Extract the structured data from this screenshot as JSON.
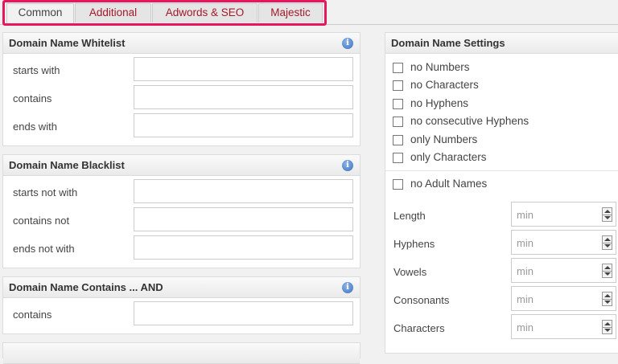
{
  "tabs": [
    {
      "label": "Common",
      "active": true
    },
    {
      "label": "Additional",
      "active": false
    },
    {
      "label": "Adwords & SEO",
      "active": false
    },
    {
      "label": "Majestic",
      "active": false
    }
  ],
  "highlight_color": "#e8175d",
  "accent_link_color": "#a3192a",
  "whitelist": {
    "title": "Domain Name Whitelist",
    "rows": [
      {
        "label": "starts with",
        "value": ""
      },
      {
        "label": "contains",
        "value": ""
      },
      {
        "label": "ends with",
        "value": ""
      }
    ]
  },
  "blacklist": {
    "title": "Domain Name Blacklist",
    "rows": [
      {
        "label": "starts not with",
        "value": ""
      },
      {
        "label": "contains not",
        "value": ""
      },
      {
        "label": "ends not with",
        "value": ""
      }
    ]
  },
  "contains_and": {
    "title": "Domain Name Contains ... AND",
    "rows": [
      {
        "label": "contains",
        "value": ""
      }
    ]
  },
  "settings": {
    "title": "Domain Name Settings",
    "checkboxes": [
      {
        "label": "no Numbers",
        "checked": false
      },
      {
        "label": "no Characters",
        "checked": false
      },
      {
        "label": "no Hyphens",
        "checked": false
      },
      {
        "label": "no consecutive Hyphens",
        "checked": false
      },
      {
        "label": "only Numbers",
        "checked": false
      },
      {
        "label": "only Characters",
        "checked": false
      }
    ],
    "adult": {
      "label": "no Adult Names",
      "checked": false
    },
    "numeric_fields": [
      {
        "label": "Length",
        "placeholder": "min"
      },
      {
        "label": "Hyphens",
        "placeholder": "min"
      },
      {
        "label": "Vowels",
        "placeholder": "min"
      },
      {
        "label": "Consonants",
        "placeholder": "min"
      },
      {
        "label": "Characters",
        "placeholder": "min"
      }
    ]
  },
  "info_icon_glyph": "i"
}
